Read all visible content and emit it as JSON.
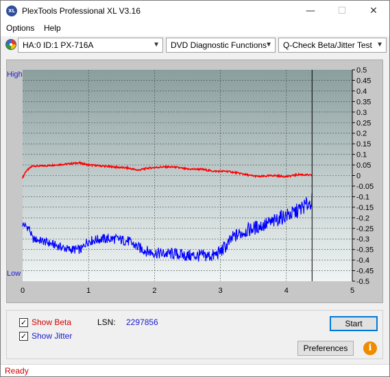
{
  "window": {
    "title": "PlexTools Professional XL V3.16",
    "app_icon_text": "XL",
    "minimize": "—",
    "maximize": "☐",
    "close": "✕"
  },
  "menu": {
    "options": "Options",
    "help": "Help"
  },
  "toolbar": {
    "drive": "HA:0 ID:1  PX-716A",
    "function": "DVD Diagnostic Functions",
    "test": "Q-Check Beta/Jitter Test"
  },
  "chart_data": {
    "type": "line",
    "left_axis_labels": {
      "top": "High",
      "bottom": "Low"
    },
    "x_ticks": [
      "0",
      "1",
      "2",
      "3",
      "4",
      "5"
    ],
    "xlim": [
      0,
      5
    ],
    "y_ticks": [
      "0.5",
      "0.45",
      "0.4",
      "0.35",
      "0.3",
      "0.25",
      "0.2",
      "0.15",
      "0.1",
      "0.05",
      "0",
      "-0.05",
      "-0.1",
      "-0.15",
      "-0.2",
      "-0.25",
      "-0.3",
      "-0.35",
      "-0.4",
      "-0.45",
      "-0.5"
    ],
    "ylim": [
      -0.5,
      0.5
    ],
    "end_marker_x": 4.39,
    "series": [
      {
        "color": "#ff0000",
        "x": [
          0.0,
          0.05,
          0.15,
          0.3,
          0.5,
          0.7,
          0.85,
          1.0,
          1.2,
          1.4,
          1.6,
          1.75,
          1.9,
          2.1,
          2.3,
          2.5,
          2.7,
          2.9,
          3.1,
          3.3,
          3.45,
          3.6,
          3.8,
          4.0,
          4.1,
          4.2,
          4.39
        ],
        "y": [
          -0.01,
          0.02,
          0.045,
          0.045,
          0.05,
          0.055,
          0.06,
          0.05,
          0.045,
          0.04,
          0.035,
          0.025,
          0.035,
          0.04,
          0.04,
          0.03,
          0.03,
          0.02,
          0.02,
          0.01,
          0.0,
          -0.005,
          0.0,
          -0.005,
          0.0,
          0.005,
          0.0
        ]
      },
      {
        "color": "#0000ff",
        "x": [
          0.0,
          0.1,
          0.15,
          0.3,
          0.5,
          0.7,
          0.9,
          0.95,
          1.0,
          1.2,
          1.4,
          1.6,
          1.75,
          1.9,
          2.1,
          2.3,
          2.5,
          2.7,
          2.9,
          3.0,
          3.1,
          3.2,
          3.4,
          3.6,
          3.8,
          3.9,
          4.0,
          4.1,
          4.2,
          4.3,
          4.39
        ],
        "y": [
          -0.23,
          -0.25,
          -0.3,
          -0.31,
          -0.33,
          -0.35,
          -0.35,
          -0.32,
          -0.31,
          -0.3,
          -0.3,
          -0.31,
          -0.34,
          -0.36,
          -0.37,
          -0.37,
          -0.38,
          -0.38,
          -0.38,
          -0.36,
          -0.33,
          -0.29,
          -0.26,
          -0.24,
          -0.22,
          -0.2,
          -0.19,
          -0.18,
          -0.16,
          -0.14,
          -0.12
        ]
      }
    ]
  },
  "bottom": {
    "show_beta": "Show Beta",
    "show_jitter": "Show Jitter",
    "lsn_label": "LSN:",
    "lsn_value": "2297856",
    "start": "Start",
    "preferences": "Preferences",
    "info": "i",
    "check": "✓"
  },
  "status": {
    "text": "Ready"
  }
}
